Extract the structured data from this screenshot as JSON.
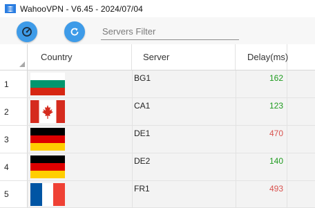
{
  "window": {
    "title": "WahooVPN - V6.45 - 2024/07/04"
  },
  "toolbar": {
    "speed_button_icon": "speedometer-icon",
    "refresh_button_icon": "refresh-icon",
    "filter_placeholder": "Servers Filter",
    "filter_value": "",
    "accent_color": "#3e9be8"
  },
  "table": {
    "columns": [
      "Country",
      "Server",
      "Delay(ms)"
    ],
    "rows": [
      {
        "num": "1",
        "country_flag": "bulgaria-flag",
        "server": "BG1",
        "delay": "162",
        "status": "good"
      },
      {
        "num": "2",
        "country_flag": "canada-flag",
        "server": "CA1",
        "delay": "123",
        "status": "good"
      },
      {
        "num": "3",
        "country_flag": "germany-flag",
        "server": "DE1",
        "delay": "470",
        "status": "bad"
      },
      {
        "num": "4",
        "country_flag": "germany-flag",
        "server": "DE2",
        "delay": "140",
        "status": "good"
      },
      {
        "num": "5",
        "country_flag": "france-flag",
        "server": "FR1",
        "delay": "493",
        "status": "bad"
      }
    ],
    "good_color": "#1f9b1f",
    "bad_color": "#d9534f"
  }
}
